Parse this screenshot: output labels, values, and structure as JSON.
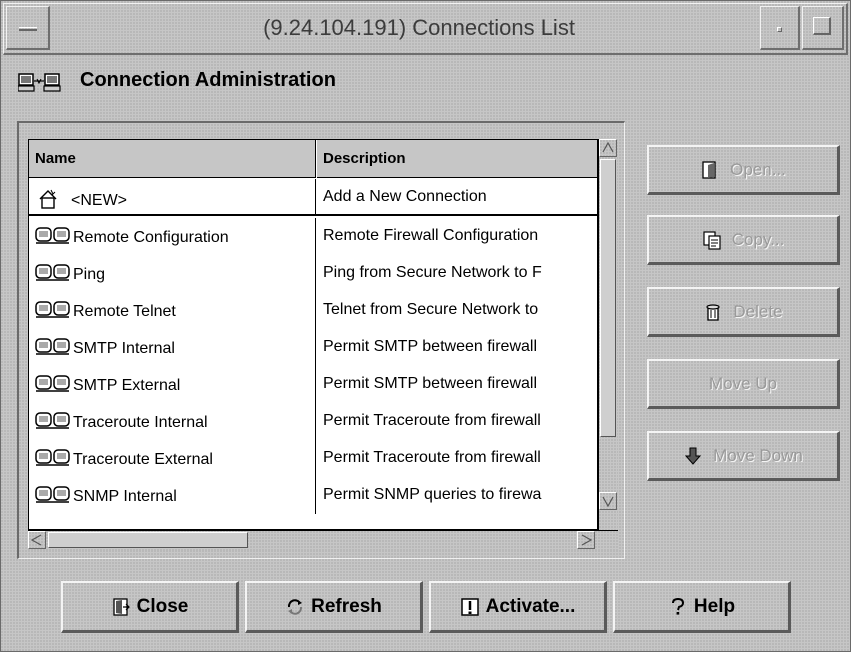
{
  "window": {
    "title": "(9.24.104.191) Connections List"
  },
  "header": {
    "title": "Connection Administration",
    "icon": "network-computers-icon"
  },
  "table": {
    "columns": [
      "Name",
      "Description"
    ],
    "rows": [
      {
        "name": "<NEW>",
        "description": "Add a New Connection",
        "icon": "new-document-icon"
      },
      {
        "name": "Remote Configuration",
        "description": "Remote Firewall Configuration",
        "icon": "connection-icon"
      },
      {
        "name": "Ping",
        "description": "Ping from Secure Network to F",
        "icon": "connection-icon"
      },
      {
        "name": "Remote Telnet",
        "description": "Telnet from Secure Network to",
        "icon": "connection-icon"
      },
      {
        "name": "SMTP Internal",
        "description": "Permit SMTP between firewall",
        "icon": "connection-icon"
      },
      {
        "name": "SMTP External",
        "description": "Permit SMTP between firewall",
        "icon": "connection-icon"
      },
      {
        "name": "Traceroute Internal",
        "description": "Permit Traceroute from firewall",
        "icon": "connection-icon"
      },
      {
        "name": "Traceroute External",
        "description": "Permit Traceroute from firewall",
        "icon": "connection-icon"
      },
      {
        "name": "SNMP Internal",
        "description": "Permit SNMP queries to firewa",
        "icon": "connection-icon"
      }
    ]
  },
  "side_buttons": {
    "open": "Open...",
    "copy": "Copy...",
    "delete": "Delete",
    "move_up": "Move Up",
    "move_down": "Move Down"
  },
  "bottom_buttons": {
    "close": "Close",
    "refresh": "Refresh",
    "activate": "Activate...",
    "help": "Help"
  }
}
